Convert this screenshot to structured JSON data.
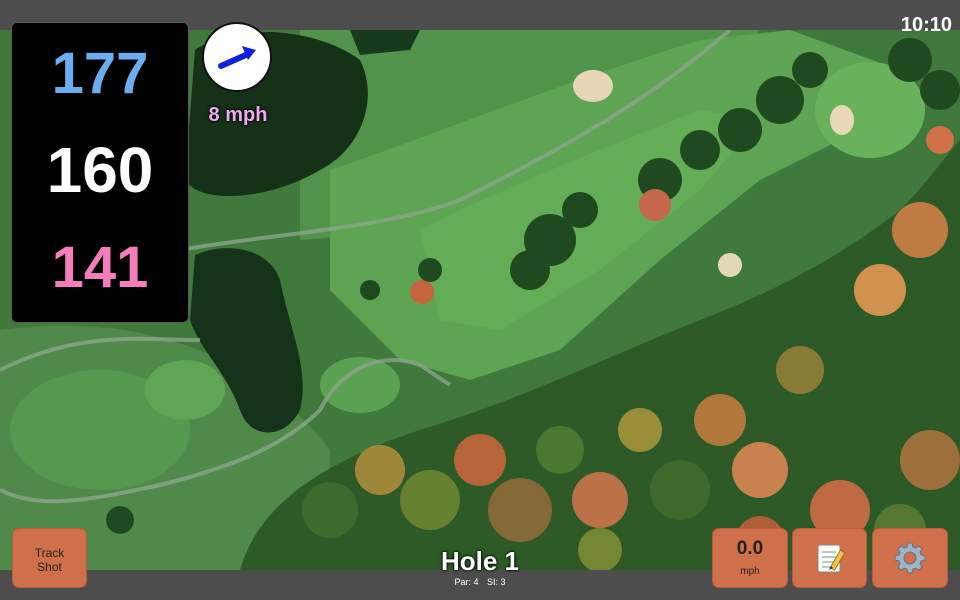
{
  "status_bar": {
    "time": "10:10"
  },
  "distances": {
    "back": "177",
    "middle": "160",
    "front": "141"
  },
  "wind": {
    "speed": "8 mph",
    "arrow_icon": "wind-direction-arrow-icon",
    "arrow_color": "#1020e0"
  },
  "hole": {
    "title": "Hole 1",
    "par": "Par: 4",
    "stroke_index": "SI: 3"
  },
  "buttons": {
    "track_shot": {
      "line1": "Track",
      "line2": "Shot"
    },
    "speed": {
      "value": "0.0",
      "unit": "mph"
    },
    "notes_icon": "notepad-icon",
    "settings_icon": "gear-icon"
  },
  "colors": {
    "button_bg": "#d0704a",
    "back_distance": "#6aaef1",
    "middle_distance": "#ffffff",
    "front_distance": "#f57dbb",
    "wind_text": "#f1a9f6"
  }
}
